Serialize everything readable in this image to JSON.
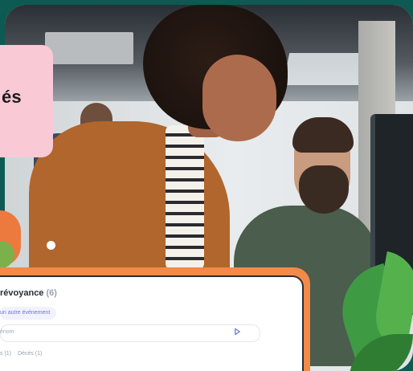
{
  "callout": {
    "text": "és"
  },
  "card": {
    "title": "révoyance",
    "count": "(6)",
    "add_event_label": "un autre événement",
    "search_placeholder": "énom",
    "filters": [
      "s (1)",
      "Décès (1)"
    ]
  },
  "colors": {
    "frame_teal": "#0d5a52",
    "callout_pink": "#f9c9d6",
    "card_accent_orange": "#f28a49",
    "link_purple": "#6f74d9"
  },
  "icons": {
    "search": "send-arrow-icon"
  }
}
